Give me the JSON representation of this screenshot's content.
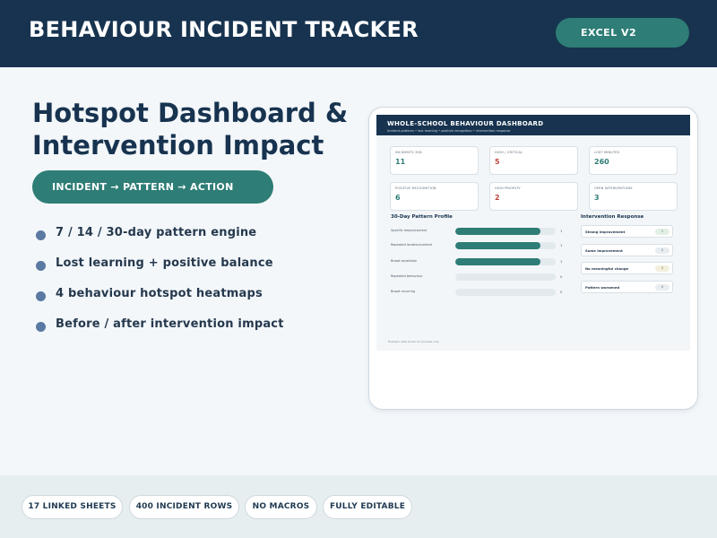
{
  "header": {
    "title": "BEHAVIOUR INCIDENT TRACKER",
    "badge": "EXCEL V2"
  },
  "hero": {
    "headline_line1": "Hotspot Dashboard &",
    "headline_line2": "Intervention Impact",
    "flow_label": "INCIDENT → PATTERN → ACTION"
  },
  "features": [
    "7 / 14 / 30-day pattern engine",
    "Lost learning + positive balance",
    "4 behaviour hotspot heatmaps",
    "Before / after intervention impact"
  ],
  "dashboard": {
    "title": "WHOLE-SCHOOL BEHAVIOUR DASHBOARD",
    "subtitle": "Incident patterns • lost learning • positive recognition • intervention response",
    "kpis": [
      {
        "label": "INCIDENTS 30D",
        "value": "11",
        "tone": "teal"
      },
      {
        "label": "HIGH / CRITICAL",
        "value": "5",
        "tone": "red"
      },
      {
        "label": "LOST MINUTES",
        "value": "260",
        "tone": "teal"
      },
      {
        "label": "POSITIVE RECOGNITION",
        "value": "6",
        "tone": "teal"
      },
      {
        "label": "HIGH PRIORITY",
        "value": "2",
        "tone": "red"
      },
      {
        "label": "OPEN INTERVENTIONS",
        "value": "3",
        "tone": "teal"
      }
    ],
    "pattern_title": "30-Day Pattern Profile",
    "patterns": [
      {
        "label": "Specific lesson/context",
        "value": "1",
        "fill": 0.85
      },
      {
        "label": "Repeated location/context",
        "value": "1",
        "fill": 0.85
      },
      {
        "label": "Broad escalation",
        "value": "1",
        "fill": 0.85
      },
      {
        "label": "Repeated behaviour",
        "value": "0",
        "fill": 0
      },
      {
        "label": "Broad recurring",
        "value": "0",
        "fill": 0
      }
    ],
    "intervention_title": "Intervention Response",
    "interventions": [
      {
        "label": "Strong improvement",
        "value": "1",
        "tone": "green"
      },
      {
        "label": "Some improvement",
        "value": "0",
        "tone": "grey"
      },
      {
        "label": "No meaningful change",
        "value": "0",
        "tone": "yellow"
      },
      {
        "label": "Pattern worsened",
        "value": "0",
        "tone": "grey"
      }
    ],
    "footnote": "Example data shown for preview only."
  },
  "tags": [
    "17 LINKED SHEETS",
    "400 INCIDENT ROWS",
    "NO MACROS",
    "FULLY EDITABLE"
  ],
  "colors": {
    "navy": "#17334f",
    "teal": "#2e7d76",
    "alert": "#c0443b",
    "bullet": "#5a79a3"
  }
}
